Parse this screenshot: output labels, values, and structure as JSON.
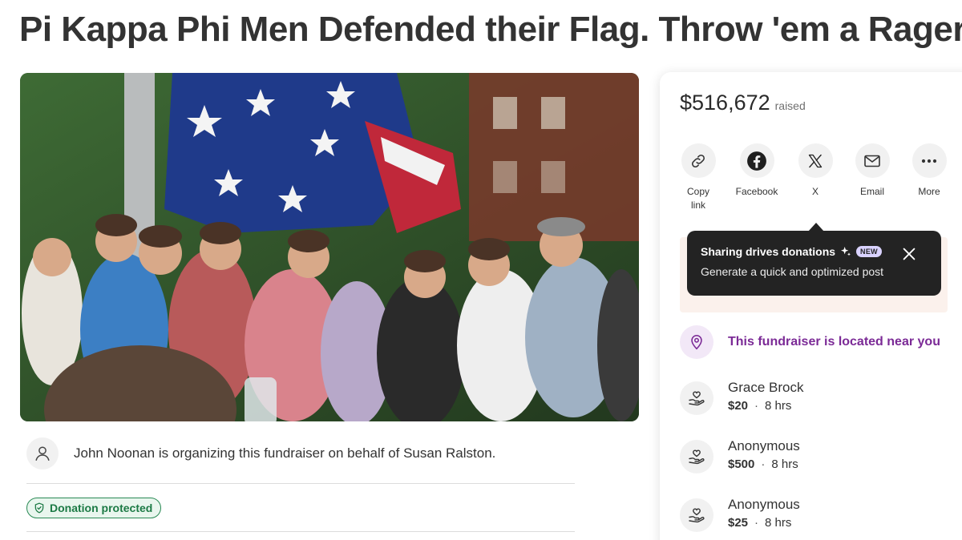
{
  "page": {
    "title": "Pi Kappa Phi Men Defended their Flag. Throw 'em a Rager"
  },
  "organizer": {
    "text": "John Noonan is organizing this fundraiser on behalf of Susan Ralston.",
    "icon": "person-icon"
  },
  "badge": {
    "label": "Donation protected",
    "icon": "shield-icon"
  },
  "progress": {
    "amount": "$516,672",
    "label": "raised"
  },
  "share": [
    {
      "label": "Copy link",
      "icon": "link-icon"
    },
    {
      "label": "Facebook",
      "icon": "facebook-icon"
    },
    {
      "label": "X",
      "icon": "x-icon"
    },
    {
      "label": "Email",
      "icon": "email-icon"
    },
    {
      "label": "More",
      "icon": "more-icon"
    }
  ],
  "tooltip": {
    "heading": "Sharing drives donations",
    "badge": "NEW",
    "body": "Generate a quick and optimized post"
  },
  "nearby": {
    "text": "This fundraiser is located near you",
    "icon": "location-pin-icon"
  },
  "donations": [
    {
      "name": "Grace Brock",
      "amount": "$20",
      "time": "8 hrs"
    },
    {
      "name": "Anonymous",
      "amount": "$500",
      "time": "8 hrs"
    },
    {
      "name": "Anonymous",
      "amount": "$25",
      "time": "8 hrs"
    }
  ],
  "colors": {
    "accent_purple": "#7b2a96",
    "protected_green": "#1c7a45",
    "tooltip_bg": "#232323"
  }
}
